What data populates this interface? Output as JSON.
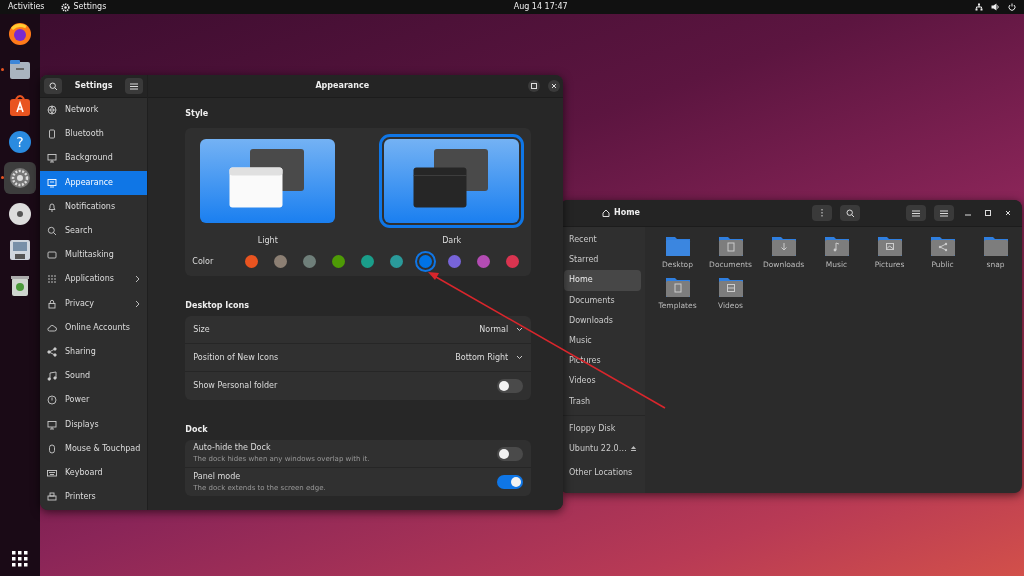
{
  "top_bar": {
    "activities": "Activities",
    "app": "Settings",
    "clock": "Aug 14  17:47"
  },
  "dock": [
    {
      "kind": "browser",
      "running": false,
      "selected": false
    },
    {
      "kind": "files",
      "running": true,
      "selected": false
    },
    {
      "kind": "software",
      "running": false,
      "selected": false
    },
    {
      "kind": "help",
      "running": false,
      "selected": false,
      "symbol": "?"
    },
    {
      "kind": "settings",
      "running": true,
      "selected": true
    },
    {
      "kind": "disc",
      "running": false,
      "selected": false
    },
    {
      "kind": "floppy",
      "running": false,
      "selected": false
    },
    {
      "kind": "trash",
      "running": false,
      "selected": false
    }
  ],
  "settings": {
    "title": "Settings",
    "page_title": "Appearance",
    "sidebar": [
      {
        "label": "Network",
        "selected": false,
        "submenu": false
      },
      {
        "label": "Bluetooth",
        "selected": false,
        "submenu": false
      },
      {
        "label": "Background",
        "selected": false,
        "submenu": false
      },
      {
        "label": "Appearance",
        "selected": true,
        "submenu": false
      },
      {
        "label": "Notifications",
        "selected": false,
        "submenu": false
      },
      {
        "label": "Search",
        "selected": false,
        "submenu": false
      },
      {
        "label": "Multitasking",
        "selected": false,
        "submenu": false
      },
      {
        "label": "Applications",
        "selected": false,
        "submenu": true
      },
      {
        "label": "Privacy",
        "selected": false,
        "submenu": true
      },
      {
        "label": "Online Accounts",
        "selected": false,
        "submenu": false
      },
      {
        "label": "Sharing",
        "selected": false,
        "submenu": false
      },
      {
        "label": "Sound",
        "selected": false,
        "submenu": false
      },
      {
        "label": "Power",
        "selected": false,
        "submenu": false
      },
      {
        "label": "Displays",
        "selected": false,
        "submenu": false
      },
      {
        "label": "Mouse & Touchpad",
        "selected": false,
        "submenu": false
      },
      {
        "label": "Keyboard",
        "selected": false,
        "submenu": false
      },
      {
        "label": "Printers",
        "selected": false,
        "submenu": false
      }
    ],
    "style": {
      "heading": "Style",
      "themes": [
        {
          "label": "Light",
          "kind": "light",
          "selected": false
        },
        {
          "label": "Dark",
          "kind": "dark",
          "selected": true
        }
      ]
    },
    "color": {
      "label": "Color",
      "swatches": [
        {
          "color": "#e95420",
          "selected": false
        },
        {
          "color": "#8c7f73",
          "selected": false
        },
        {
          "color": "#6f7f7a",
          "selected": false
        },
        {
          "color": "#4e9a06",
          "selected": false
        },
        {
          "color": "#1a9e8a",
          "selected": false
        },
        {
          "color": "#2a9a9a",
          "selected": false
        },
        {
          "color": "#0073e5",
          "selected": true
        },
        {
          "color": "#7764d8",
          "selected": false
        },
        {
          "color": "#b34cb3",
          "selected": false
        },
        {
          "color": "#da3450",
          "selected": false
        }
      ]
    },
    "sections": [
      {
        "heading": "Desktop Icons",
        "rows": [
          {
            "kind": "dropdown",
            "label": "Size",
            "value": "Normal"
          },
          {
            "kind": "dropdown",
            "label": "Position of New Icons",
            "value": "Bottom Right"
          },
          {
            "kind": "switch",
            "label": "Show Personal folder",
            "on": false
          }
        ]
      },
      {
        "heading": "Dock",
        "rows": [
          {
            "kind": "switch",
            "label": "Auto-hide the Dock",
            "description": "The dock hides when any windows overlap with it.",
            "on": false
          },
          {
            "kind": "switch",
            "label": "Panel mode",
            "description": "The dock extends to the screen edge.",
            "on": true
          }
        ]
      }
    ]
  },
  "files": {
    "title": "Home",
    "places": [
      {
        "label": "Recent",
        "selected": false
      },
      {
        "label": "Starred",
        "selected": false
      },
      {
        "label": "Home",
        "selected": true
      },
      {
        "label": "Documents",
        "selected": false
      },
      {
        "label": "Downloads",
        "selected": false
      },
      {
        "label": "Music",
        "selected": false
      },
      {
        "label": "Pictures",
        "selected": false
      },
      {
        "label": "Videos",
        "selected": false
      },
      {
        "label": "Trash",
        "selected": false
      }
    ],
    "devices": [
      {
        "label": "Floppy Disk",
        "eject": false
      },
      {
        "label": "Ubuntu 22.0…",
        "eject": true
      }
    ],
    "other": "Other Locations",
    "folders": [
      {
        "label": "Desktop",
        "accent": true
      },
      {
        "label": "Documents",
        "accent": false
      },
      {
        "label": "Downloads",
        "accent": false
      },
      {
        "label": "Music",
        "accent": false
      },
      {
        "label": "Pictures",
        "accent": false
      },
      {
        "label": "Public",
        "accent": false
      },
      {
        "label": "snap",
        "accent": false
      },
      {
        "label": "Templates",
        "accent": false
      },
      {
        "label": "Videos",
        "accent": false
      }
    ]
  }
}
